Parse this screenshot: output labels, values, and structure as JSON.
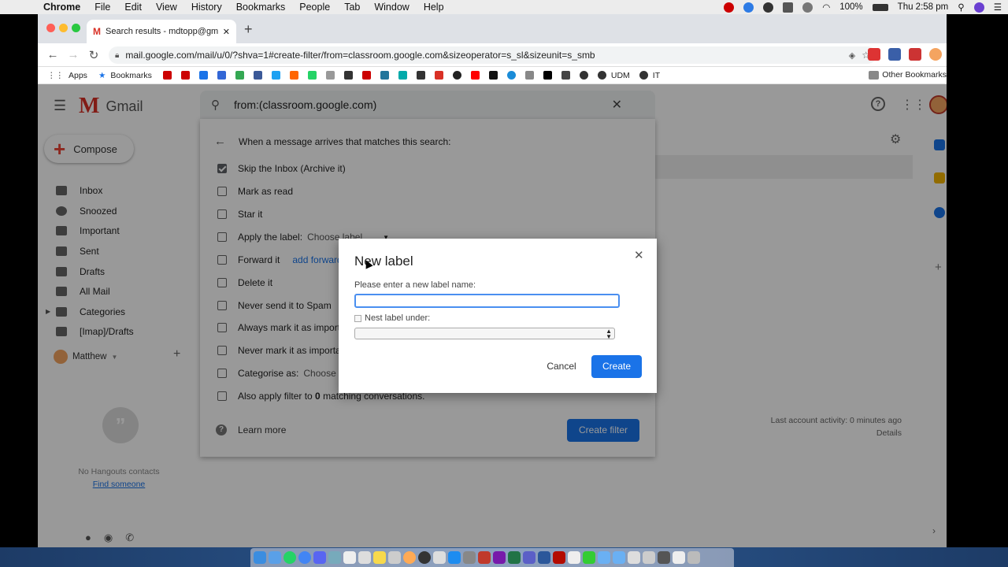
{
  "menubar": {
    "items": [
      "Chrome",
      "File",
      "Edit",
      "View",
      "History",
      "Bookmarks",
      "People",
      "Tab",
      "Window",
      "Help"
    ],
    "battery": "100%",
    "clock": "Thu 2:58 pm"
  },
  "browser": {
    "tab_title": "Search results - mdtopp@gmail...",
    "url": "mail.google.com/mail/u/0/?shva=1#create-filter/from=classroom.google.com&sizeoperator=s_sl&sizeunit=s_smb",
    "bookmarks": [
      "Apps",
      "Bookmarks",
      "UDM",
      "IT"
    ],
    "other_bookmarks": "Other Bookmarks"
  },
  "gmail": {
    "product": "Gmail",
    "search_value": "from:(classroom.google.com)",
    "compose": "Compose",
    "nav": [
      "Inbox",
      "Snoozed",
      "Important",
      "Sent",
      "Drafts",
      "All Mail",
      "Categories",
      "[Imap]/Drafts"
    ],
    "user": "Matthew",
    "no_contacts": "No Hangouts contacts",
    "find_someone": "Find someone",
    "last_activity": "Last account activity: 0 minutes ago",
    "details": "Details"
  },
  "filter": {
    "heading": "When a message arrives that matches this search:",
    "options": [
      {
        "label": "Skip the Inbox (Archive it)",
        "checked": true
      },
      {
        "label": "Mark as read",
        "checked": false
      },
      {
        "label": "Star it",
        "checked": false
      },
      {
        "label": "Apply the label:",
        "extra": "Choose label",
        "checked": false
      },
      {
        "label": "Forward it",
        "extra": "add forwarding",
        "checked": false
      },
      {
        "label": "Delete it",
        "checked": false
      },
      {
        "label": "Never send it to Spam",
        "checked": false
      },
      {
        "label": "Always mark it as important",
        "checked": false
      },
      {
        "label": "Never mark it as important",
        "checked": false
      },
      {
        "label": "Categorise as:",
        "extra": "Choose category",
        "checked": false
      }
    ],
    "also_apply_pre": "Also apply filter to ",
    "also_apply_count": "0",
    "also_apply_post": " matching conversations.",
    "learn_more": "Learn more",
    "create_filter": "Create filter"
  },
  "dialog": {
    "title": "New label",
    "prompt": "Please enter a new label name:",
    "input_value": "",
    "nest_label": "Nest label under:",
    "cancel": "Cancel",
    "create": "Create"
  },
  "colors": {
    "accent": "#1a73e8",
    "gmail_red": "#d93025"
  }
}
